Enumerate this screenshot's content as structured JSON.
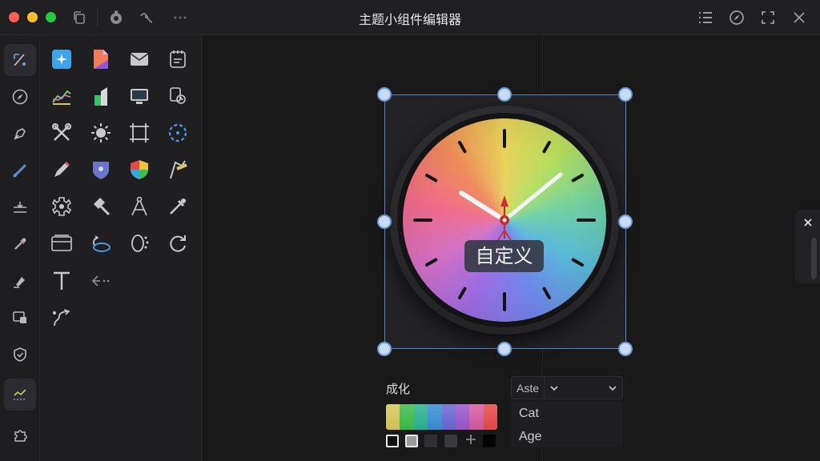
{
  "window": {
    "title": "主题小组件编辑器"
  },
  "titlebar": {
    "left_icons": [
      "copy-icon",
      "timer-icon",
      "branch-icon",
      "more-icon"
    ],
    "right_icons": [
      "list-icon",
      "compass-icon",
      "fullscreen-icon",
      "close-icon"
    ]
  },
  "rail": {
    "tools": [
      "select-tool-icon",
      "compass-tool-icon",
      "pen-tool-icon",
      "brush-tool-icon",
      "align-tool-icon",
      "pipette-tool-icon",
      "highlighter-tool-icon",
      "screen-tool-icon",
      "shield-tool-icon",
      "graph-tool-icon",
      "puzzle-tool-icon"
    ],
    "active": "graph-tool-icon"
  },
  "palette": {
    "icons": [
      "sparkle-icon",
      "document-icon",
      "mail-icon",
      "notepad-icon",
      "chart-icon",
      "bar-icon",
      "monitor-icon",
      "refresh-doc-icon",
      "wrench-icon",
      "sun-icon",
      "frame-icon",
      "dashed-circle-icon",
      "pencil-icon",
      "badge-icon",
      "shield-icon",
      "signal-icon",
      "gear-icon",
      "hammer-icon",
      "compass-icon",
      "dropper-icon",
      "card-icon",
      "loop-icon",
      "loading-icon",
      "rotate-icon",
      "text-icon",
      "arrow-left-icon",
      "route-icon"
    ]
  },
  "widget": {
    "label": "自定义",
    "face_colors": [
      "#e8d15a",
      "#b6de5e",
      "#6fd0a1",
      "#58b8d8",
      "#6e86e8",
      "#9a6be2",
      "#d26fc4",
      "#ef6a8a",
      "#ef8a5a"
    ]
  },
  "properties": {
    "section_label": "成化",
    "swatch_colors": [
      "#d8c95a",
      "#3bbf4a",
      "#2bb48e",
      "#3a8fd6",
      "#6b68d6",
      "#9b57cc",
      "#d65ba4",
      "#e84b4b"
    ],
    "mini_swatches": [
      "#111111",
      "#9a9a9a",
      "#2f2f31",
      "#3a3a3c",
      "#ffffff",
      "#050505"
    ],
    "dropdown": {
      "value": "Aste",
      "options": [
        "Cat",
        "Age"
      ]
    }
  }
}
